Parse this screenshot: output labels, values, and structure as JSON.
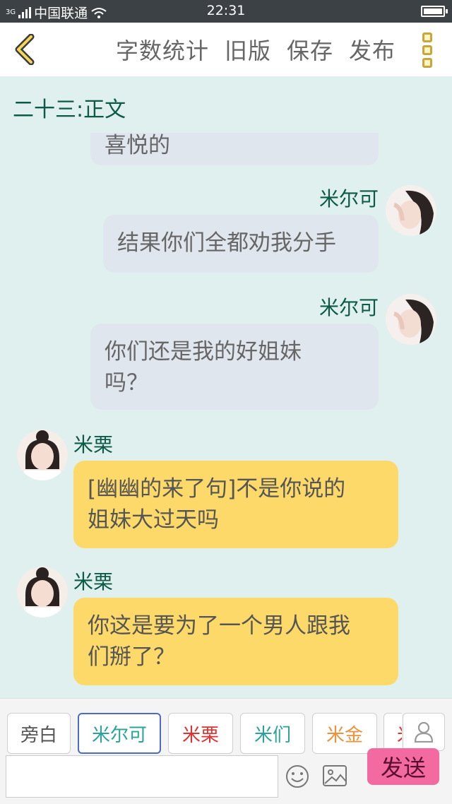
{
  "status_bar": {
    "signal_tag": "3G",
    "carrier": "中国联通",
    "time": "22:31"
  },
  "nav": {
    "word_count": "字数统计",
    "old_version": "旧版",
    "save": "保存",
    "publish": "发布"
  },
  "chapter_title": "二十三:正文",
  "chat": {
    "partial_text": "喜悦的",
    "messages": [
      {
        "sender": "米尔可",
        "text": "结果你们全都劝我分手"
      },
      {
        "sender": "米尔可",
        "text_line1": "你们还是我的好姐妹",
        "text_line2": "吗？"
      },
      {
        "sender": "米栗",
        "text_line1": "[幽幽的来了句]不是你说的",
        "text_line2": "姐妹大过天吗"
      },
      {
        "sender": "米栗",
        "text_line1": "你这是要为了一个男人跟我",
        "text_line2": "们掰了？"
      }
    ]
  },
  "roles": [
    {
      "label": "旁白",
      "color": "#555555"
    },
    {
      "label": "米尔可",
      "color": "#2aa39a"
    },
    {
      "label": "米栗",
      "color": "#e0312f"
    },
    {
      "label": "米们",
      "color": "#2aa39a"
    },
    {
      "label": "米金",
      "color": "#f0913a"
    },
    {
      "label": "米",
      "color": "#e0312f"
    }
  ],
  "input": {
    "value": "",
    "placeholder": ""
  },
  "send_label": "发送",
  "icons": {
    "back": "chevron-left-icon",
    "more": "more-vertical-icon",
    "person": "person-icon",
    "emoji": "emoji-icon",
    "image": "image-icon"
  }
}
